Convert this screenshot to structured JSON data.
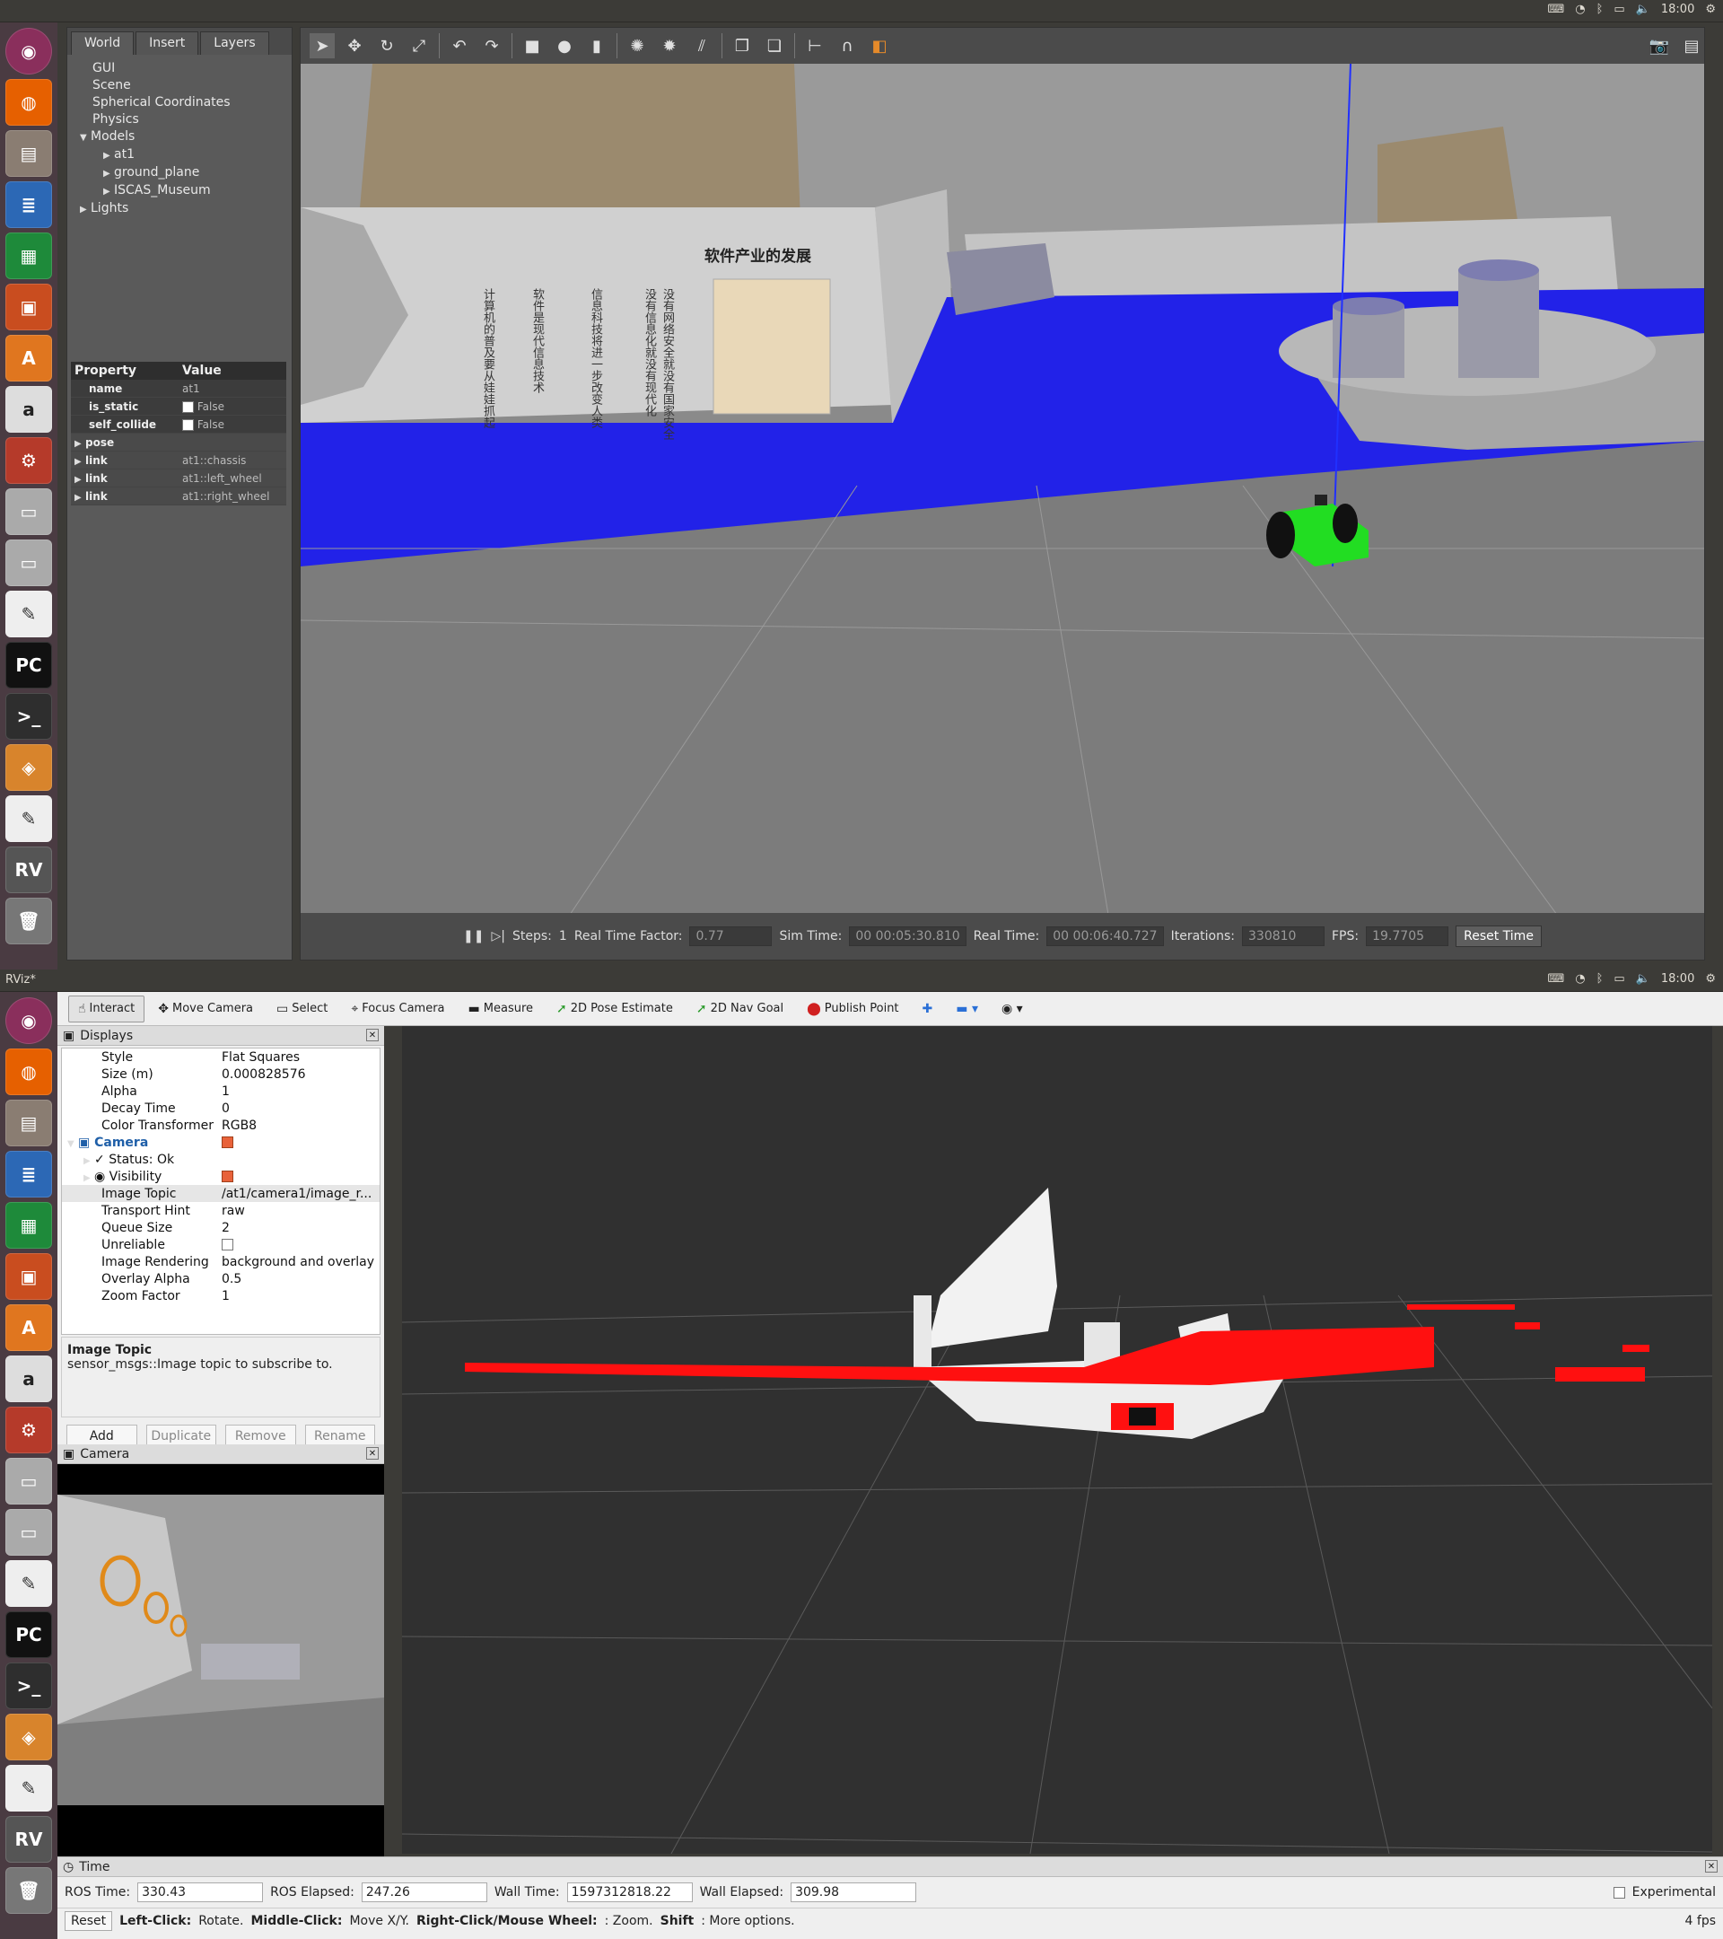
{
  "top": {
    "tray": {
      "time": "18:00"
    },
    "tree": {
      "tabs": [
        "World",
        "Insert",
        "Layers"
      ],
      "items": [
        "GUI",
        "Scene",
        "Spherical Coordinates",
        "Physics",
        "Models",
        "at1",
        "ground_plane",
        "ISCAS_Museum",
        "Lights"
      ]
    },
    "props": {
      "header": [
        "Property",
        "Value"
      ],
      "rows": [
        {
          "k": "name",
          "v": "at1"
        },
        {
          "k": "is_static",
          "v": "False"
        },
        {
          "k": "self_collide",
          "v": "False"
        },
        {
          "k": "pose",
          "v": ""
        },
        {
          "k": "link",
          "v": "at1::chassis"
        },
        {
          "k": "link",
          "v": "at1::left_wheel"
        },
        {
          "k": "link",
          "v": "at1::right_wheel"
        }
      ]
    },
    "scene": {
      "sign_title": "软件产业的发展",
      "sign_columns": [
        "没有网络安全就没有国家安全",
        "没有信息化就没有现代化",
        "信息科技将进一步改变人类",
        "软件是现代信息技术",
        "计算机的普及要从娃娃抓起"
      ]
    },
    "status": {
      "steps_label": "Steps:",
      "steps_value": "1",
      "rtf_label": "Real Time Factor:",
      "rtf": "0.77",
      "sim_label": "Sim Time:",
      "sim": "00 00:05:30.810",
      "real_label": "Real Time:",
      "real": "00 00:06:40.727",
      "iter_label": "Iterations:",
      "iter": "330810",
      "fps_label": "FPS:",
      "fps": "19.7705",
      "reset": "Reset Time"
    }
  },
  "bottom": {
    "title": "RViz*",
    "tray": {
      "time": "18:00"
    },
    "tools": [
      "Interact",
      "Move Camera",
      "Select",
      "Focus Camera",
      "Measure",
      "2D Pose Estimate",
      "2D Nav Goal",
      "Publish Point"
    ],
    "displays_title": "Displays",
    "displays": [
      {
        "k": "Style",
        "v": "Flat Squares"
      },
      {
        "k": "Size (m)",
        "v": "0.000828576"
      },
      {
        "k": "Alpha",
        "v": "1"
      },
      {
        "k": "Decay Time",
        "v": "0"
      },
      {
        "k": "Color Transformer",
        "v": "RGB8"
      },
      {
        "k": "Camera",
        "v": ""
      },
      {
        "k": "Status: Ok",
        "v": ""
      },
      {
        "k": "Visibility",
        "v": ""
      },
      {
        "k": "Image Topic",
        "v": "/at1/camera1/image_r..."
      },
      {
        "k": "Transport Hint",
        "v": "raw"
      },
      {
        "k": "Queue Size",
        "v": "2"
      },
      {
        "k": "Unreliable",
        "v": ""
      },
      {
        "k": "Image Rendering",
        "v": "background and overlay"
      },
      {
        "k": "Overlay Alpha",
        "v": "0.5"
      },
      {
        "k": "Zoom Factor",
        "v": "1"
      }
    ],
    "desc_title": "Image Topic",
    "desc_text": "sensor_msgs::Image topic to subscribe to.",
    "buttons": [
      "Add",
      "Duplicate",
      "Remove",
      "Rename"
    ],
    "camera_title": "Camera",
    "time_title": "Time",
    "time": {
      "ros_time_label": "ROS Time:",
      "ros_time": "330.43",
      "ros_elapsed_label": "ROS Elapsed:",
      "ros_elapsed": "247.26",
      "wall_time_label": "Wall Time:",
      "wall_time": "1597312818.22",
      "wall_elapsed_label": "Wall Elapsed:",
      "wall_elapsed": "309.98",
      "experimental": "Experimental"
    },
    "status": {
      "reset": "Reset",
      "help_a": "Left-Click:",
      "help_a2": "Rotate.",
      "help_b": "Middle-Click:",
      "help_b2": "Move X/Y.",
      "help_c": "Right-Click/Mouse Wheel:",
      "help_c2": ": Zoom.",
      "help_d": "Shift",
      "help_d2": ": More options.",
      "fps": "4 fps"
    }
  },
  "launcher": [
    "ubuntu",
    "firefox",
    "files",
    "writer",
    "calc",
    "impress",
    "software",
    "amazon",
    "settings",
    "drive",
    "drive2",
    "editor",
    "pycharm",
    "terminal",
    "sublime",
    "gedit",
    "rviz",
    "trash"
  ]
}
